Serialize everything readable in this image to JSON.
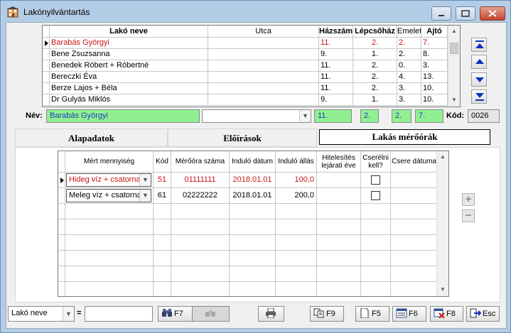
{
  "window": {
    "title": "Lakónyilvántartás",
    "app_icon": "building-icon",
    "buttons": [
      "minimize-icon",
      "maximize-icon",
      "close-icon"
    ]
  },
  "residents_grid": {
    "columns": [
      "Lakó neve",
      "Utca",
      "Házszám",
      "Lépcsőház",
      "Emelet",
      "Ajtó"
    ],
    "rows": [
      {
        "name": "Barabás Györgyi",
        "street": "",
        "house": "11.",
        "stair": "2.",
        "floor": "2.",
        "door": "7.",
        "selected": true
      },
      {
        "name": "Bene Zsuzsanna",
        "street": "",
        "house": "9.",
        "stair": "1.",
        "floor": "2.",
        "door": "8.",
        "selected": false
      },
      {
        "name": "Benedek Róbert + Róbertné",
        "street": "",
        "house": "11.",
        "stair": "2.",
        "floor": "0.",
        "door": "3.",
        "selected": false
      },
      {
        "name": "Bereczki Éva",
        "street": "",
        "house": "11.",
        "stair": "2.",
        "floor": "4.",
        "door": "13.",
        "selected": false
      },
      {
        "name": "Berze Lajos + Béla",
        "street": "",
        "house": "11.",
        "stair": "2.",
        "floor": "3.",
        "door": "10.",
        "selected": false
      },
      {
        "name": "Dr Gulyás Miklós",
        "street": "",
        "house": "9.",
        "stair": "1.",
        "floor": "3.",
        "door": "10.",
        "selected": false
      }
    ]
  },
  "nav_buttons": [
    "first-record-icon",
    "prev-record-icon",
    "next-record-icon",
    "last-record-icon"
  ],
  "detail": {
    "name_label": "Név:",
    "name_value": "Barabás Györgyi",
    "street_value": "",
    "house": "11.",
    "stair": "2.",
    "floor": "2.",
    "door": "7.",
    "code_label": "Kód:",
    "code_value": "0026"
  },
  "tabs": [
    {
      "label": "Alapadatok",
      "active": false
    },
    {
      "label": "Előírások",
      "active": false
    },
    {
      "label": "Lakás mérőórák",
      "active": true
    }
  ],
  "meters_grid": {
    "columns": [
      "Mért mennyiség",
      "Kód",
      "Mérőóra száma",
      "Induló dátum",
      "Induló állás",
      "Hitelesítés lejárati éve",
      "Cserélni kell?",
      "Csere dátuma"
    ],
    "rows": [
      {
        "quantity": "Hideg víz + csatorna",
        "code": "51",
        "meter_no": "01111111",
        "start_date": "2018.01.01",
        "start_value": "100,0",
        "expiry": "",
        "replace": false,
        "replace_date": "",
        "selected": true
      },
      {
        "quantity": "Meleg víz + csatorna",
        "code": "61",
        "meter_no": "02222222",
        "start_date": "2018.01.01",
        "start_value": "200,0",
        "expiry": "",
        "replace": false,
        "replace_date": "",
        "selected": false
      }
    ]
  },
  "side_buttons": {
    "add": "+",
    "remove": "−"
  },
  "toolbar": {
    "search_field": "Lakó neve",
    "equals": "=",
    "search_value": "",
    "buttons": [
      {
        "label": "F7",
        "icon": "binoculars-icon"
      },
      {
        "label": "",
        "icon": "binoculars-disabled-icon"
      },
      {
        "label": "",
        "icon": "printer-icon"
      },
      {
        "label": "F9",
        "icon": "copy-icon"
      },
      {
        "label": "F5",
        "icon": "new-document-icon"
      },
      {
        "label": "F6",
        "icon": "edit-icon"
      },
      {
        "label": "F8",
        "icon": "delete-icon"
      },
      {
        "label": "Esc",
        "icon": "exit-icon"
      }
    ]
  },
  "colors": {
    "highlight_text": "#cc1111",
    "field_green": "#90f090",
    "frame": "#b4cde6"
  }
}
